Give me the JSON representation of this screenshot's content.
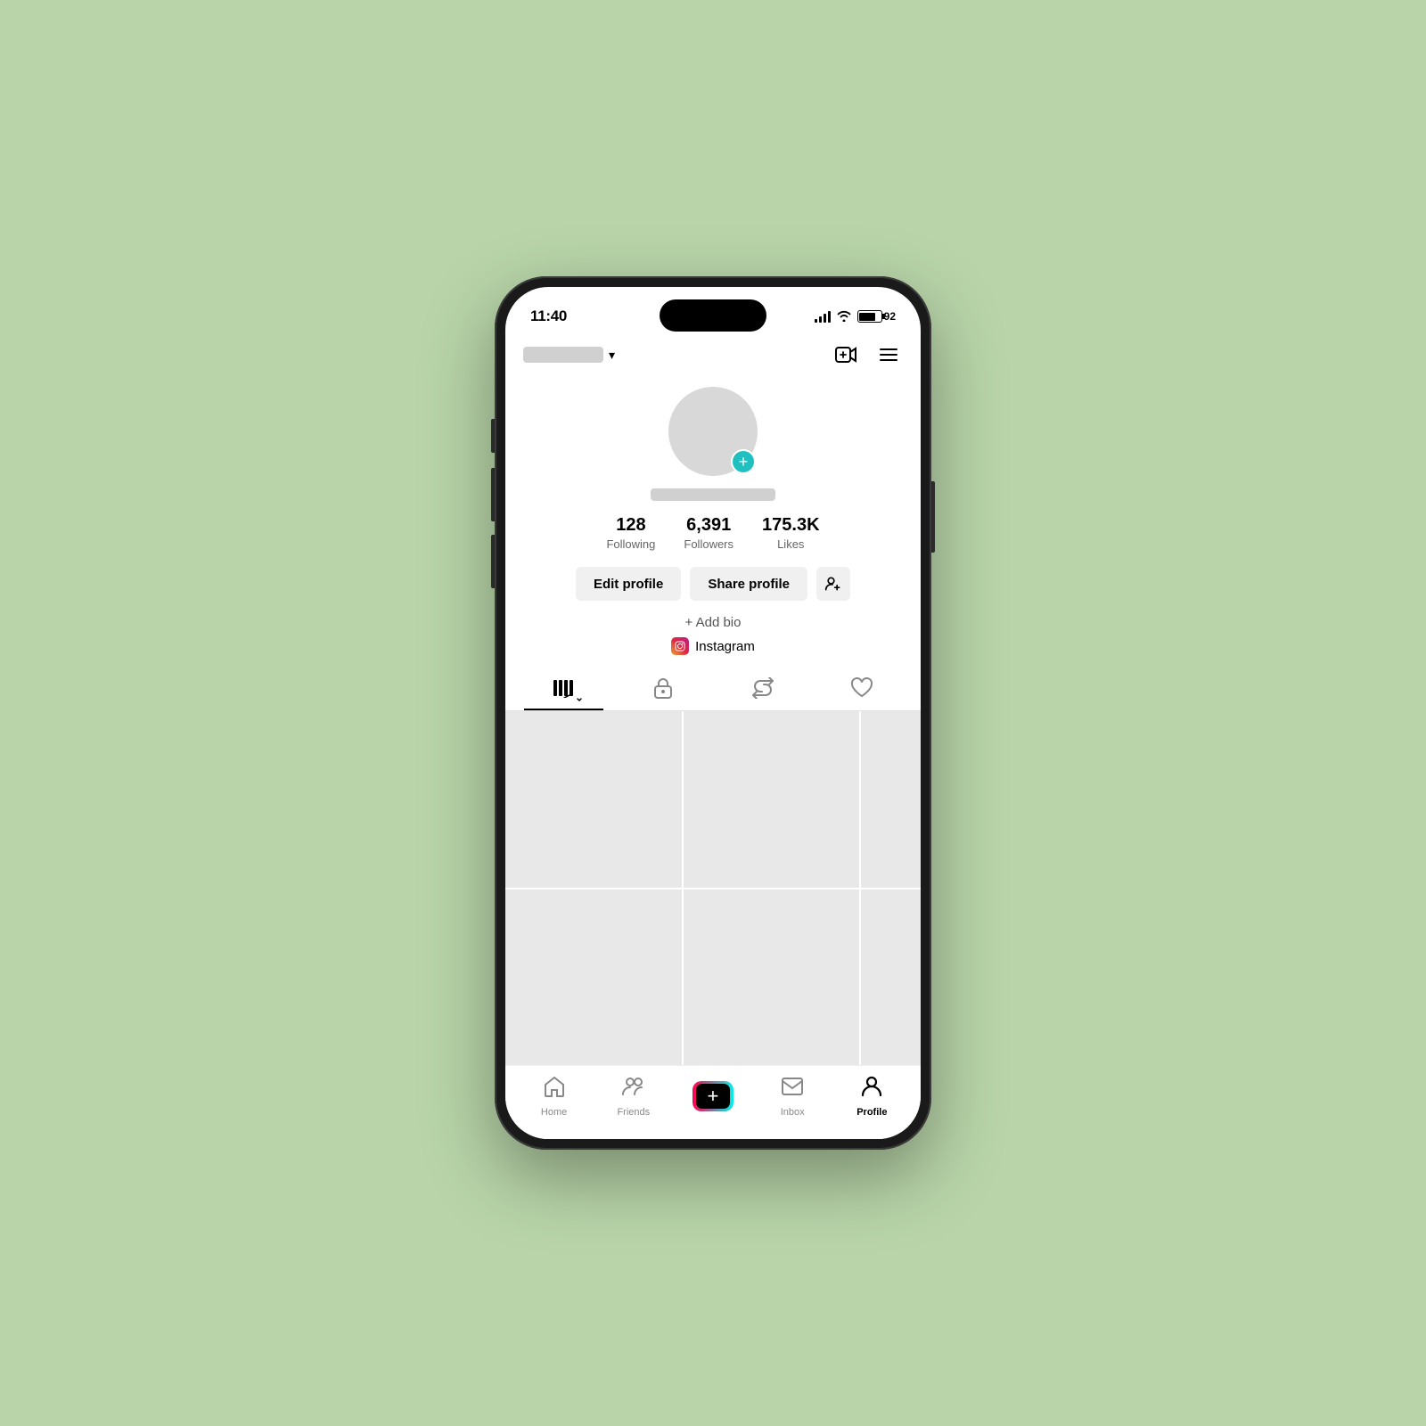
{
  "statusBar": {
    "time": "11:40",
    "batteryLevel": "92",
    "batteryPercent": "92"
  },
  "header": {
    "usernameLabel": "",
    "addVideoLabel": "⊕",
    "menuLabel": "☰"
  },
  "profile": {
    "followingCount": "128",
    "followingLabel": "Following",
    "followersCount": "6,391",
    "followersLabel": "Followers",
    "likesCount": "175.3K",
    "likesLabel": "Likes",
    "editProfileLabel": "Edit profile",
    "shareProfileLabel": "Share profile",
    "addBioLabel": "+ Add bio",
    "instagramLabel": "Instagram"
  },
  "tabs": {
    "videosLabel": "|||",
    "privateLabel": "🔒",
    "repostedLabel": "↩",
    "likedLabel": "♡"
  },
  "bottomNav": {
    "homeLabel": "Home",
    "friendsLabel": "Friends",
    "inboxLabel": "Inbox",
    "profileLabel": "Profile"
  }
}
